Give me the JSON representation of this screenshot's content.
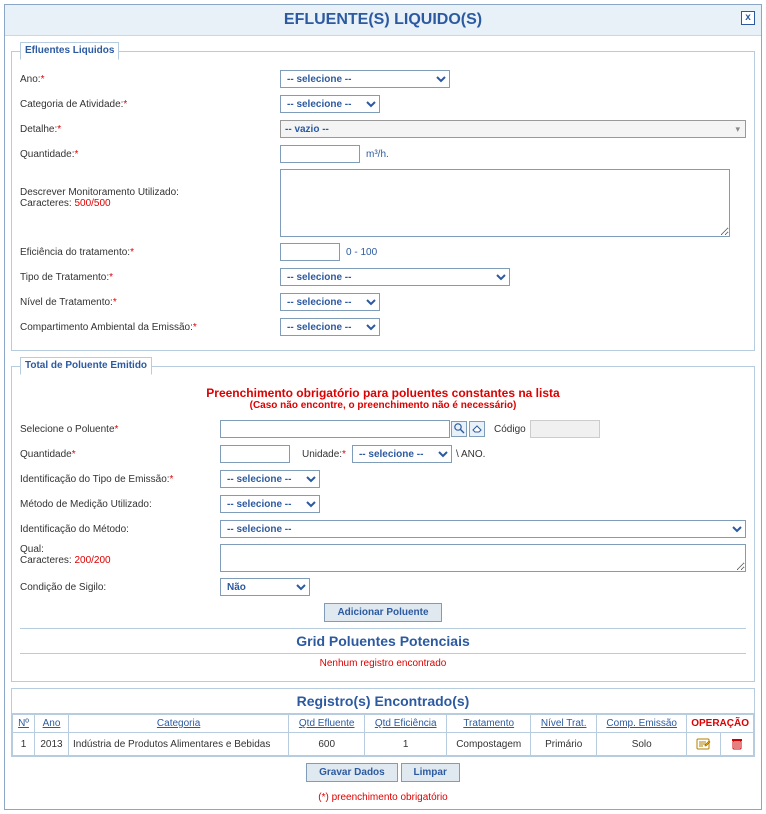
{
  "window": {
    "title": "EFLUENTE(S) LIQUIDO(S)",
    "close_label": "x"
  },
  "fieldset1": {
    "legend": "Efluentes Liquidos",
    "ano_label": "Ano:",
    "ano_selected": "-- selecione --",
    "categoria_label": "Categoria de Atividade:",
    "categoria_selected": "-- selecione --",
    "detalhe_label": "Detalhe:",
    "detalhe_selected": "-- vazio --",
    "quantidade_label": "Quantidade:",
    "quantidade_value": "",
    "quantidade_unit": "m³/h.",
    "monitor_label_l1": "Descrever Monitoramento Utilizado:",
    "monitor_caracteres_prefix": "Caracteres: ",
    "monitor_caracteres_count": "500/500",
    "monitor_value": "",
    "eficiencia_label": "Eficiência do tratamento:",
    "eficiencia_value": "",
    "eficiencia_range": "0 - 100",
    "tipo_trat_label": "Tipo de Tratamento:",
    "tipo_trat_selected": "-- selecione --",
    "nivel_trat_label": "Nível de Tratamento:",
    "nivel_trat_selected": "-- selecione --",
    "compartimento_label": "Compartimento Ambiental da Emissão:",
    "compartimento_selected": "-- selecione --"
  },
  "fieldset2": {
    "legend": "Total de Poluente Emitido",
    "subtitle": "Preenchimento obrigatório para poluentes constantes na lista",
    "subtitle2": "(Caso não encontre, o preenchimento não é necessário)",
    "selecione_poluente_label": "Selecione o Poluente",
    "poluente_value": "",
    "codigo_label": "Código",
    "quantidade_label": "Quantidade",
    "quantidade_value": "",
    "unidade_label": "Unidade:",
    "unidade_selected": "-- selecione --",
    "unidade_suffix": "\\ ANO.",
    "ident_tipo_label": "Identificação do Tipo de Emissão:",
    "ident_tipo_selected": "-- selecione --",
    "metodo_medicao_label": "Método de Medição Utilizado:",
    "metodo_medicao_selected": "-- selecione --",
    "ident_metodo_label": "Identificação do Método:",
    "ident_metodo_selected": "-- selecione --",
    "qual_label": "Qual:",
    "qual_caracteres_prefix": "Caracteres: ",
    "qual_caracteres_count": "200/200",
    "qual_value": "",
    "condicao_sigilo_label": "Condição de Sigilo:",
    "condicao_sigilo_selected": "Não",
    "add_button_label": "Adicionar Poluente",
    "grid_title": "Grid Poluentes Potenciais",
    "no_records": "Nenhum registro encontrado"
  },
  "table": {
    "title": "Registro(s) Encontrado(s)",
    "headers": {
      "num": "Nº",
      "ano": "Ano",
      "categoria": "Categoria",
      "qtd_efluente": "Qtd Efluente",
      "qtd_eficiencia": "Qtd Eficiência",
      "tratamento": "Tratamento",
      "nivel_trat": "Nível Trat.",
      "comp_emissao": "Comp. Emissão",
      "operacao": "OPERAÇÃO"
    },
    "rows": [
      {
        "num": "1",
        "ano": "2013",
        "categoria": "Indústria de Produtos Alimentares e Bebidas",
        "qtd_efluente": "600",
        "qtd_eficiencia": "1",
        "tratamento": "Compostagem",
        "nivel_trat": "Primário",
        "comp_emissao": "Solo"
      }
    ]
  },
  "footer": {
    "gravar_label": "Gravar Dados",
    "limpar_label": "Limpar",
    "note": "(*) preenchimento obrigatório"
  },
  "icons": {
    "search": "search-icon",
    "eraser": "eraser-icon",
    "edit": "edit-icon",
    "delete": "delete-icon",
    "close": "close-icon",
    "dropdown": "chevron-down-icon"
  }
}
